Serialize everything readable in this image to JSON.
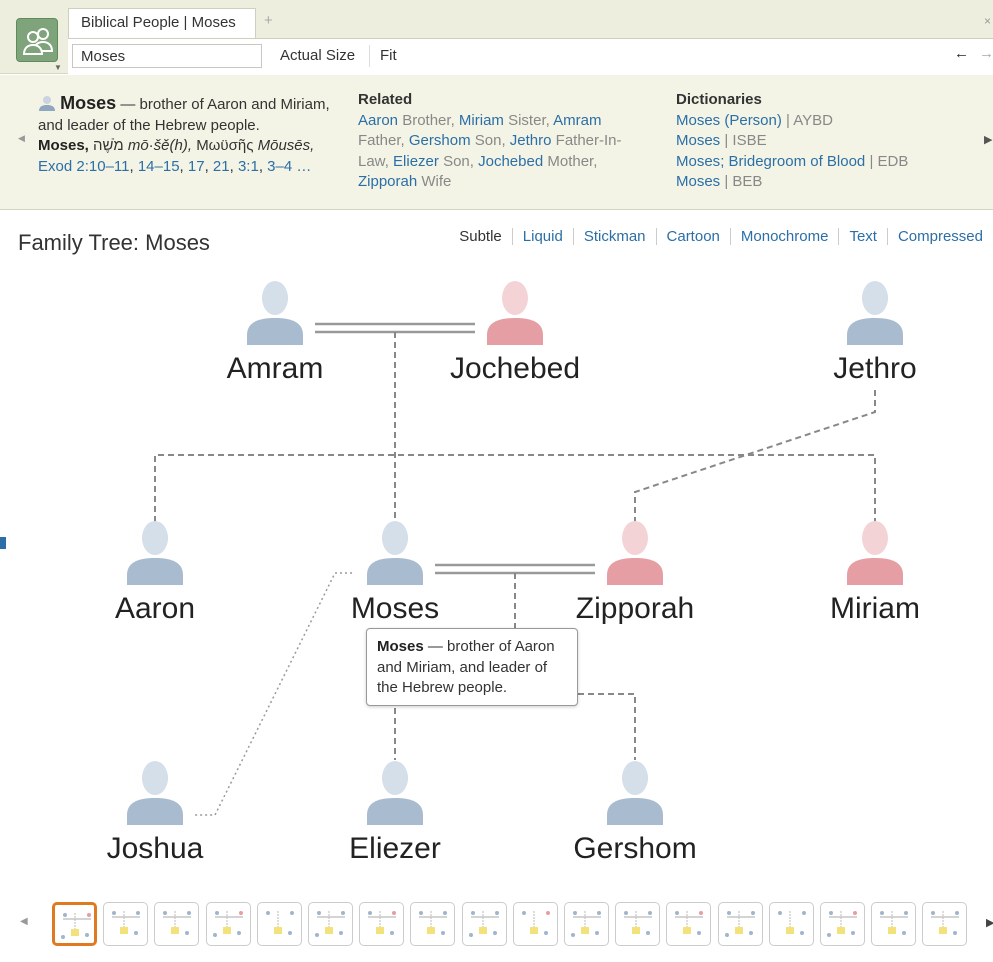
{
  "tab": {
    "title": "Biblical People | Moses",
    "add": "+",
    "close": "×"
  },
  "toolbar": {
    "search_value": "Moses",
    "actual_size": "Actual Size",
    "fit": "Fit",
    "back": "←",
    "forward": "→"
  },
  "info": {
    "summary": {
      "name": "Moses",
      "desc": " — brother of Aaron and Miriam, and leader of the Hebrew people.",
      "moses_label": "Moses,",
      "hebrew": "מֹשֶׁה",
      "translit": "mō·šě(h),",
      "greek": "Μωϋσῆς",
      "greek_translit": "Mōusēs,",
      "ref_label": "Exod",
      "refs": [
        "2:10–11",
        "14–15",
        "17",
        "21",
        "3:1",
        "3–4 …"
      ]
    },
    "related": {
      "heading": "Related",
      "items": [
        {
          "name": "Aaron",
          "rel": "Brother"
        },
        {
          "name": "Miriam",
          "rel": "Sister"
        },
        {
          "name": "Amram",
          "rel": "Father"
        },
        {
          "name": "Gershom",
          "rel": "Son"
        },
        {
          "name": "Jethro",
          "rel": "Father-In-Law"
        },
        {
          "name": "Eliezer",
          "rel": "Son"
        },
        {
          "name": "Jochebed",
          "rel": "Mother"
        },
        {
          "name": "Zipporah",
          "rel": "Wife"
        }
      ]
    },
    "dictionaries": {
      "heading": "Dictionaries",
      "items": [
        {
          "link": "Moses (Person)",
          "src": "AYBD"
        },
        {
          "link": "Moses",
          "src": "ISBE"
        },
        {
          "link": "Moses",
          "link2": "Bridegroom of Blood",
          "src": "EDB"
        },
        {
          "link": "Moses",
          "src": "BEB"
        }
      ]
    }
  },
  "main": {
    "title": "Family Tree: Moses",
    "styles": [
      "Subtle",
      "Liquid",
      "Stickman",
      "Cartoon",
      "Monochrome",
      "Text",
      "Compressed"
    ]
  },
  "people": {
    "amram": "Amram",
    "jochebed": "Jochebed",
    "jethro": "Jethro",
    "aaron": "Aaron",
    "moses": "Moses",
    "zipporah": "Zipporah",
    "miriam": "Miriam",
    "joshua": "Joshua",
    "eliezer": "Eliezer",
    "gershom": "Gershom"
  },
  "tooltip": {
    "name": "Moses",
    "text": " — brother of Aaron and Miriam, and leader of the Hebrew people."
  },
  "colors": {
    "male": "#a9bccf",
    "female": "#e59ea3",
    "link": "#2b6fa6",
    "selected_thumb": "#e07a20"
  },
  "thumbnails": {
    "count": 18,
    "selected_index": 0
  }
}
